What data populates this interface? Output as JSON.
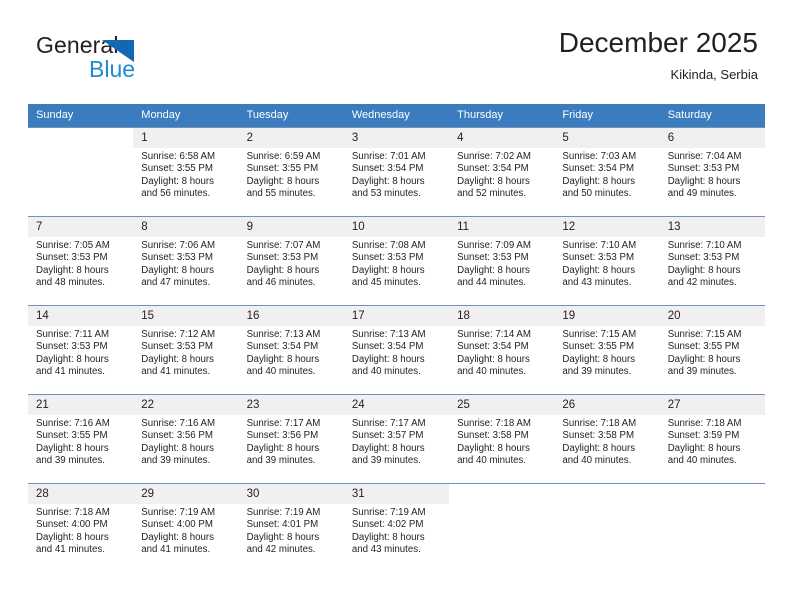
{
  "brand": {
    "name_dark": "General",
    "name_light": "Blue",
    "mark": "triangle-logo"
  },
  "header": {
    "title": "December 2025",
    "location": "Kikinda, Serbia"
  },
  "colors": {
    "header_blue": "#3a7cbe",
    "brand_dark": "#231f20",
    "brand_blue": "#1e8bcd",
    "mark_blue": "#1268b3",
    "daynum_band": "#f0f0f0",
    "week_rule": "#7391b4"
  },
  "weekdays": [
    "Sunday",
    "Monday",
    "Tuesday",
    "Wednesday",
    "Thursday",
    "Friday",
    "Saturday"
  ],
  "weeks": [
    [
      {
        "empty": true
      },
      {
        "day": "1",
        "sunrise": "Sunrise: 6:58 AM",
        "sunset": "Sunset: 3:55 PM",
        "daylight1": "Daylight: 8 hours",
        "daylight2": "and 56 minutes."
      },
      {
        "day": "2",
        "sunrise": "Sunrise: 6:59 AM",
        "sunset": "Sunset: 3:55 PM",
        "daylight1": "Daylight: 8 hours",
        "daylight2": "and 55 minutes."
      },
      {
        "day": "3",
        "sunrise": "Sunrise: 7:01 AM",
        "sunset": "Sunset: 3:54 PM",
        "daylight1": "Daylight: 8 hours",
        "daylight2": "and 53 minutes."
      },
      {
        "day": "4",
        "sunrise": "Sunrise: 7:02 AM",
        "sunset": "Sunset: 3:54 PM",
        "daylight1": "Daylight: 8 hours",
        "daylight2": "and 52 minutes."
      },
      {
        "day": "5",
        "sunrise": "Sunrise: 7:03 AM",
        "sunset": "Sunset: 3:54 PM",
        "daylight1": "Daylight: 8 hours",
        "daylight2": "and 50 minutes."
      },
      {
        "day": "6",
        "sunrise": "Sunrise: 7:04 AM",
        "sunset": "Sunset: 3:53 PM",
        "daylight1": "Daylight: 8 hours",
        "daylight2": "and 49 minutes."
      }
    ],
    [
      {
        "day": "7",
        "sunrise": "Sunrise: 7:05 AM",
        "sunset": "Sunset: 3:53 PM",
        "daylight1": "Daylight: 8 hours",
        "daylight2": "and 48 minutes."
      },
      {
        "day": "8",
        "sunrise": "Sunrise: 7:06 AM",
        "sunset": "Sunset: 3:53 PM",
        "daylight1": "Daylight: 8 hours",
        "daylight2": "and 47 minutes."
      },
      {
        "day": "9",
        "sunrise": "Sunrise: 7:07 AM",
        "sunset": "Sunset: 3:53 PM",
        "daylight1": "Daylight: 8 hours",
        "daylight2": "and 46 minutes."
      },
      {
        "day": "10",
        "sunrise": "Sunrise: 7:08 AM",
        "sunset": "Sunset: 3:53 PM",
        "daylight1": "Daylight: 8 hours",
        "daylight2": "and 45 minutes."
      },
      {
        "day": "11",
        "sunrise": "Sunrise: 7:09 AM",
        "sunset": "Sunset: 3:53 PM",
        "daylight1": "Daylight: 8 hours",
        "daylight2": "and 44 minutes."
      },
      {
        "day": "12",
        "sunrise": "Sunrise: 7:10 AM",
        "sunset": "Sunset: 3:53 PM",
        "daylight1": "Daylight: 8 hours",
        "daylight2": "and 43 minutes."
      },
      {
        "day": "13",
        "sunrise": "Sunrise: 7:10 AM",
        "sunset": "Sunset: 3:53 PM",
        "daylight1": "Daylight: 8 hours",
        "daylight2": "and 42 minutes."
      }
    ],
    [
      {
        "day": "14",
        "sunrise": "Sunrise: 7:11 AM",
        "sunset": "Sunset: 3:53 PM",
        "daylight1": "Daylight: 8 hours",
        "daylight2": "and 41 minutes."
      },
      {
        "day": "15",
        "sunrise": "Sunrise: 7:12 AM",
        "sunset": "Sunset: 3:53 PM",
        "daylight1": "Daylight: 8 hours",
        "daylight2": "and 41 minutes."
      },
      {
        "day": "16",
        "sunrise": "Sunrise: 7:13 AM",
        "sunset": "Sunset: 3:54 PM",
        "daylight1": "Daylight: 8 hours",
        "daylight2": "and 40 minutes."
      },
      {
        "day": "17",
        "sunrise": "Sunrise: 7:13 AM",
        "sunset": "Sunset: 3:54 PM",
        "daylight1": "Daylight: 8 hours",
        "daylight2": "and 40 minutes."
      },
      {
        "day": "18",
        "sunrise": "Sunrise: 7:14 AM",
        "sunset": "Sunset: 3:54 PM",
        "daylight1": "Daylight: 8 hours",
        "daylight2": "and 40 minutes."
      },
      {
        "day": "19",
        "sunrise": "Sunrise: 7:15 AM",
        "sunset": "Sunset: 3:55 PM",
        "daylight1": "Daylight: 8 hours",
        "daylight2": "and 39 minutes."
      },
      {
        "day": "20",
        "sunrise": "Sunrise: 7:15 AM",
        "sunset": "Sunset: 3:55 PM",
        "daylight1": "Daylight: 8 hours",
        "daylight2": "and 39 minutes."
      }
    ],
    [
      {
        "day": "21",
        "sunrise": "Sunrise: 7:16 AM",
        "sunset": "Sunset: 3:55 PM",
        "daylight1": "Daylight: 8 hours",
        "daylight2": "and 39 minutes."
      },
      {
        "day": "22",
        "sunrise": "Sunrise: 7:16 AM",
        "sunset": "Sunset: 3:56 PM",
        "daylight1": "Daylight: 8 hours",
        "daylight2": "and 39 minutes."
      },
      {
        "day": "23",
        "sunrise": "Sunrise: 7:17 AM",
        "sunset": "Sunset: 3:56 PM",
        "daylight1": "Daylight: 8 hours",
        "daylight2": "and 39 minutes."
      },
      {
        "day": "24",
        "sunrise": "Sunrise: 7:17 AM",
        "sunset": "Sunset: 3:57 PM",
        "daylight1": "Daylight: 8 hours",
        "daylight2": "and 39 minutes."
      },
      {
        "day": "25",
        "sunrise": "Sunrise: 7:18 AM",
        "sunset": "Sunset: 3:58 PM",
        "daylight1": "Daylight: 8 hours",
        "daylight2": "and 40 minutes."
      },
      {
        "day": "26",
        "sunrise": "Sunrise: 7:18 AM",
        "sunset": "Sunset: 3:58 PM",
        "daylight1": "Daylight: 8 hours",
        "daylight2": "and 40 minutes."
      },
      {
        "day": "27",
        "sunrise": "Sunrise: 7:18 AM",
        "sunset": "Sunset: 3:59 PM",
        "daylight1": "Daylight: 8 hours",
        "daylight2": "and 40 minutes."
      }
    ],
    [
      {
        "day": "28",
        "sunrise": "Sunrise: 7:18 AM",
        "sunset": "Sunset: 4:00 PM",
        "daylight1": "Daylight: 8 hours",
        "daylight2": "and 41 minutes."
      },
      {
        "day": "29",
        "sunrise": "Sunrise: 7:19 AM",
        "sunset": "Sunset: 4:00 PM",
        "daylight1": "Daylight: 8 hours",
        "daylight2": "and 41 minutes."
      },
      {
        "day": "30",
        "sunrise": "Sunrise: 7:19 AM",
        "sunset": "Sunset: 4:01 PM",
        "daylight1": "Daylight: 8 hours",
        "daylight2": "and 42 minutes."
      },
      {
        "day": "31",
        "sunrise": "Sunrise: 7:19 AM",
        "sunset": "Sunset: 4:02 PM",
        "daylight1": "Daylight: 8 hours",
        "daylight2": "and 43 minutes."
      },
      {
        "empty": true
      },
      {
        "empty": true
      },
      {
        "empty": true
      }
    ]
  ]
}
